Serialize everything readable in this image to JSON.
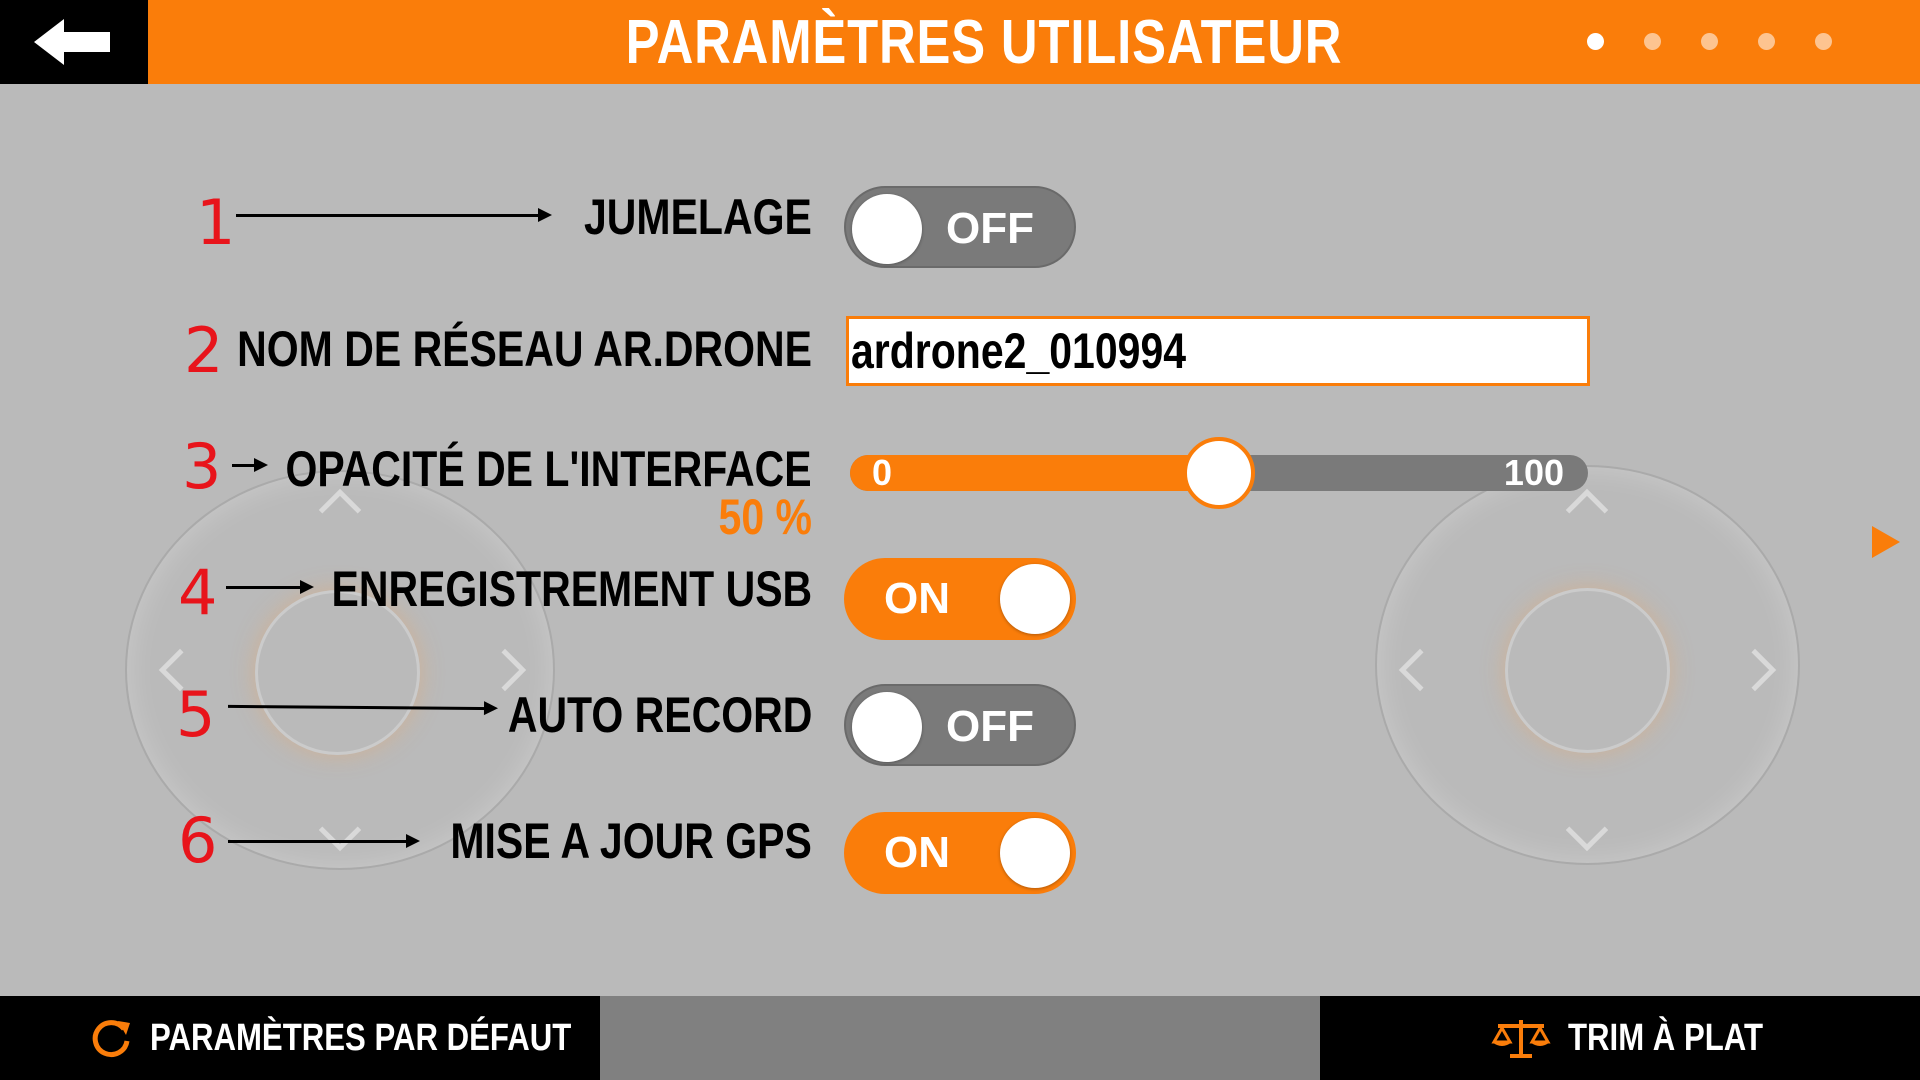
{
  "header": {
    "title": "PARAMÈTRES UTILISATEUR",
    "page_count": 5,
    "active_page": 1
  },
  "rows": {
    "pairing": {
      "marker": "1",
      "label": "JUMELAGE",
      "state": "OFF"
    },
    "network_name": {
      "marker": "2",
      "label": "NOM DE RÉSEAU AR.DRONE",
      "value": "ardrone2_010994"
    },
    "opacity": {
      "marker": "3",
      "label": "OPACITÉ DE L'INTERFACE",
      "min_label": "0",
      "max_label": "100",
      "value": 50,
      "value_text": "50 %"
    },
    "usb_recording": {
      "marker": "4",
      "label": "ENREGISTREMENT USB",
      "state": "ON"
    },
    "auto_record": {
      "marker": "5",
      "label": "AUTO RECORD",
      "state": "OFF"
    },
    "gps_update": {
      "marker": "6",
      "label": "MISE A JOUR GPS",
      "state": "ON"
    }
  },
  "footer": {
    "default_settings_label": "PARAMÈTRES PAR DÉFAUT",
    "flat_trim_label": "TRIM À PLAT"
  },
  "icons": {
    "back": "arrow-left-icon",
    "reset": "refresh-icon",
    "trim": "balance-scale-icon",
    "next": "triangle-right-icon"
  },
  "colors": {
    "accent": "#fa7d0a",
    "background": "#bababa",
    "marker": "#e8141b",
    "toggle_off": "#7a7a7a"
  }
}
